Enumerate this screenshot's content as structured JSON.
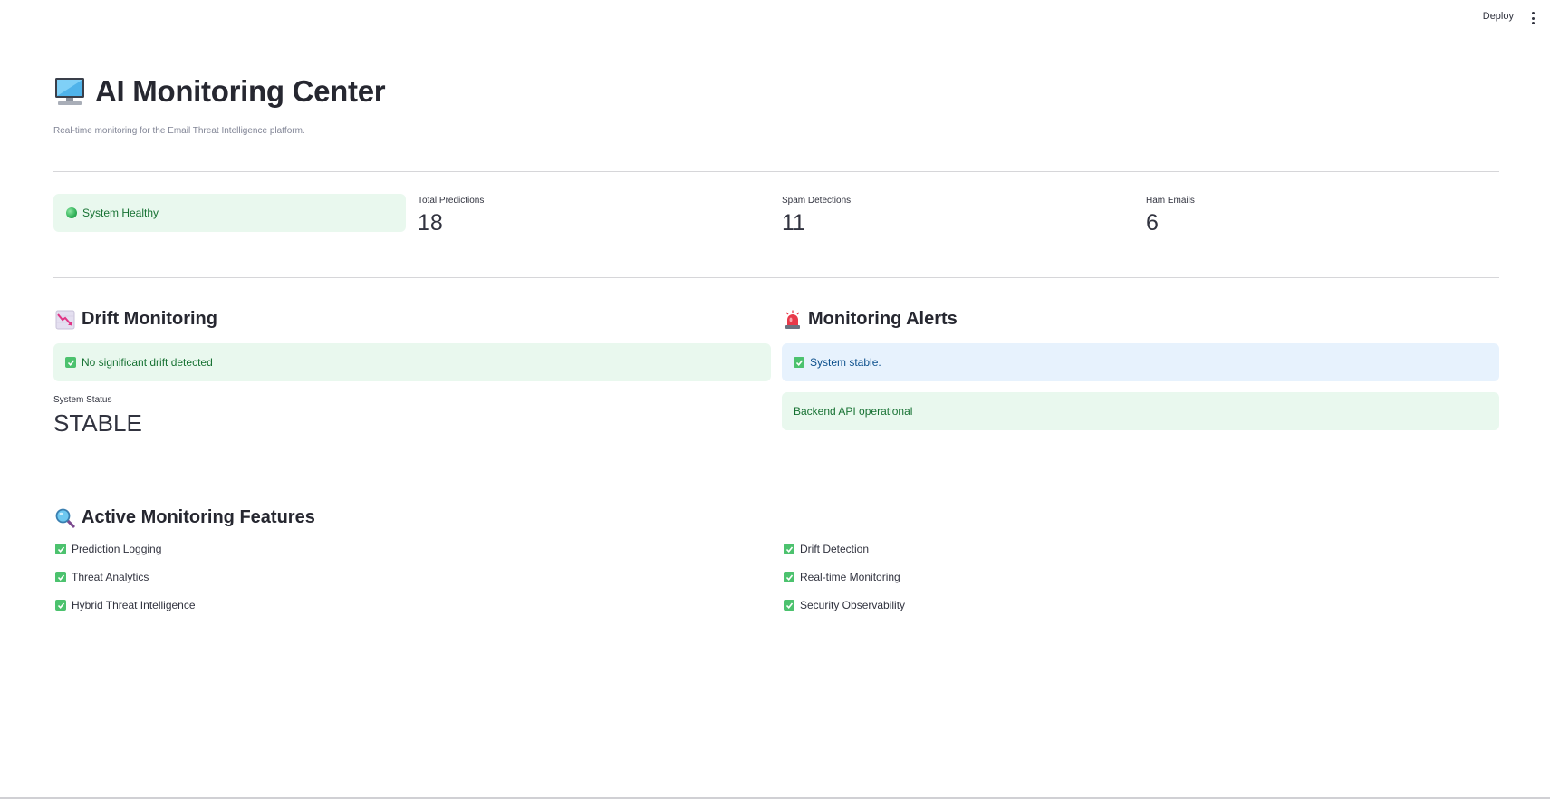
{
  "toolbar": {
    "deploy_label": "Deploy",
    "menu_icon": "more-vertical-icon"
  },
  "header": {
    "title": "AI Monitoring Center",
    "title_icon": "desktop-computer-icon",
    "subtitle": "Real-time monitoring for the Email Threat Intelligence platform."
  },
  "status": {
    "health_label": "System Healthy",
    "health_icon": "green-circle-icon",
    "color": "#177233",
    "bg": "#e9f8ee"
  },
  "metrics": [
    {
      "label": "Total Predictions",
      "value": "18"
    },
    {
      "label": "Spam Detections",
      "value": "11"
    },
    {
      "label": "Ham Emails",
      "value": "6"
    }
  ],
  "drift": {
    "heading": "Drift Monitoring",
    "heading_icon": "chart-decreasing-icon",
    "alert": "No significant drift detected",
    "status_label": "System Status",
    "status_value": "STABLE"
  },
  "alerts": {
    "heading": "Monitoring Alerts",
    "heading_icon": "rotating-light-icon",
    "info": "System stable.",
    "success": "Backend API operational",
    "info_color": "#0b4f8c",
    "info_bg": "#e7f2fd"
  },
  "features": {
    "heading": "Active Monitoring Features",
    "heading_icon": "magnifying-glass-icon",
    "left": [
      "Prediction Logging",
      "Threat Analytics",
      "Hybrid Threat Intelligence"
    ],
    "right": [
      "Drift Detection",
      "Real-time Monitoring",
      "Security Observability"
    ]
  }
}
